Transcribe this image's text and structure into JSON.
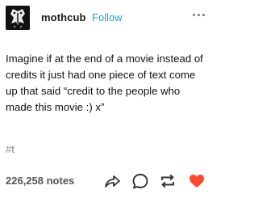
{
  "post": {
    "username": "mothcub",
    "follow_label": "Follow",
    "text": "Imagine if at the end of a movie instead of credits it just had one piece of text come up that said “credit to the people who made this movie :) x”",
    "tag": "#t",
    "notes": "226,258 notes"
  },
  "icons": {
    "avatar": "moth-avatar",
    "more": "ellipsis-icon",
    "share": "share-icon",
    "reply": "reply-icon",
    "reblog": "reblog-icon",
    "like": "heart-icon"
  },
  "colors": {
    "follow": "#1ea1f2",
    "like": "#ff4930",
    "muted": "#555555"
  }
}
